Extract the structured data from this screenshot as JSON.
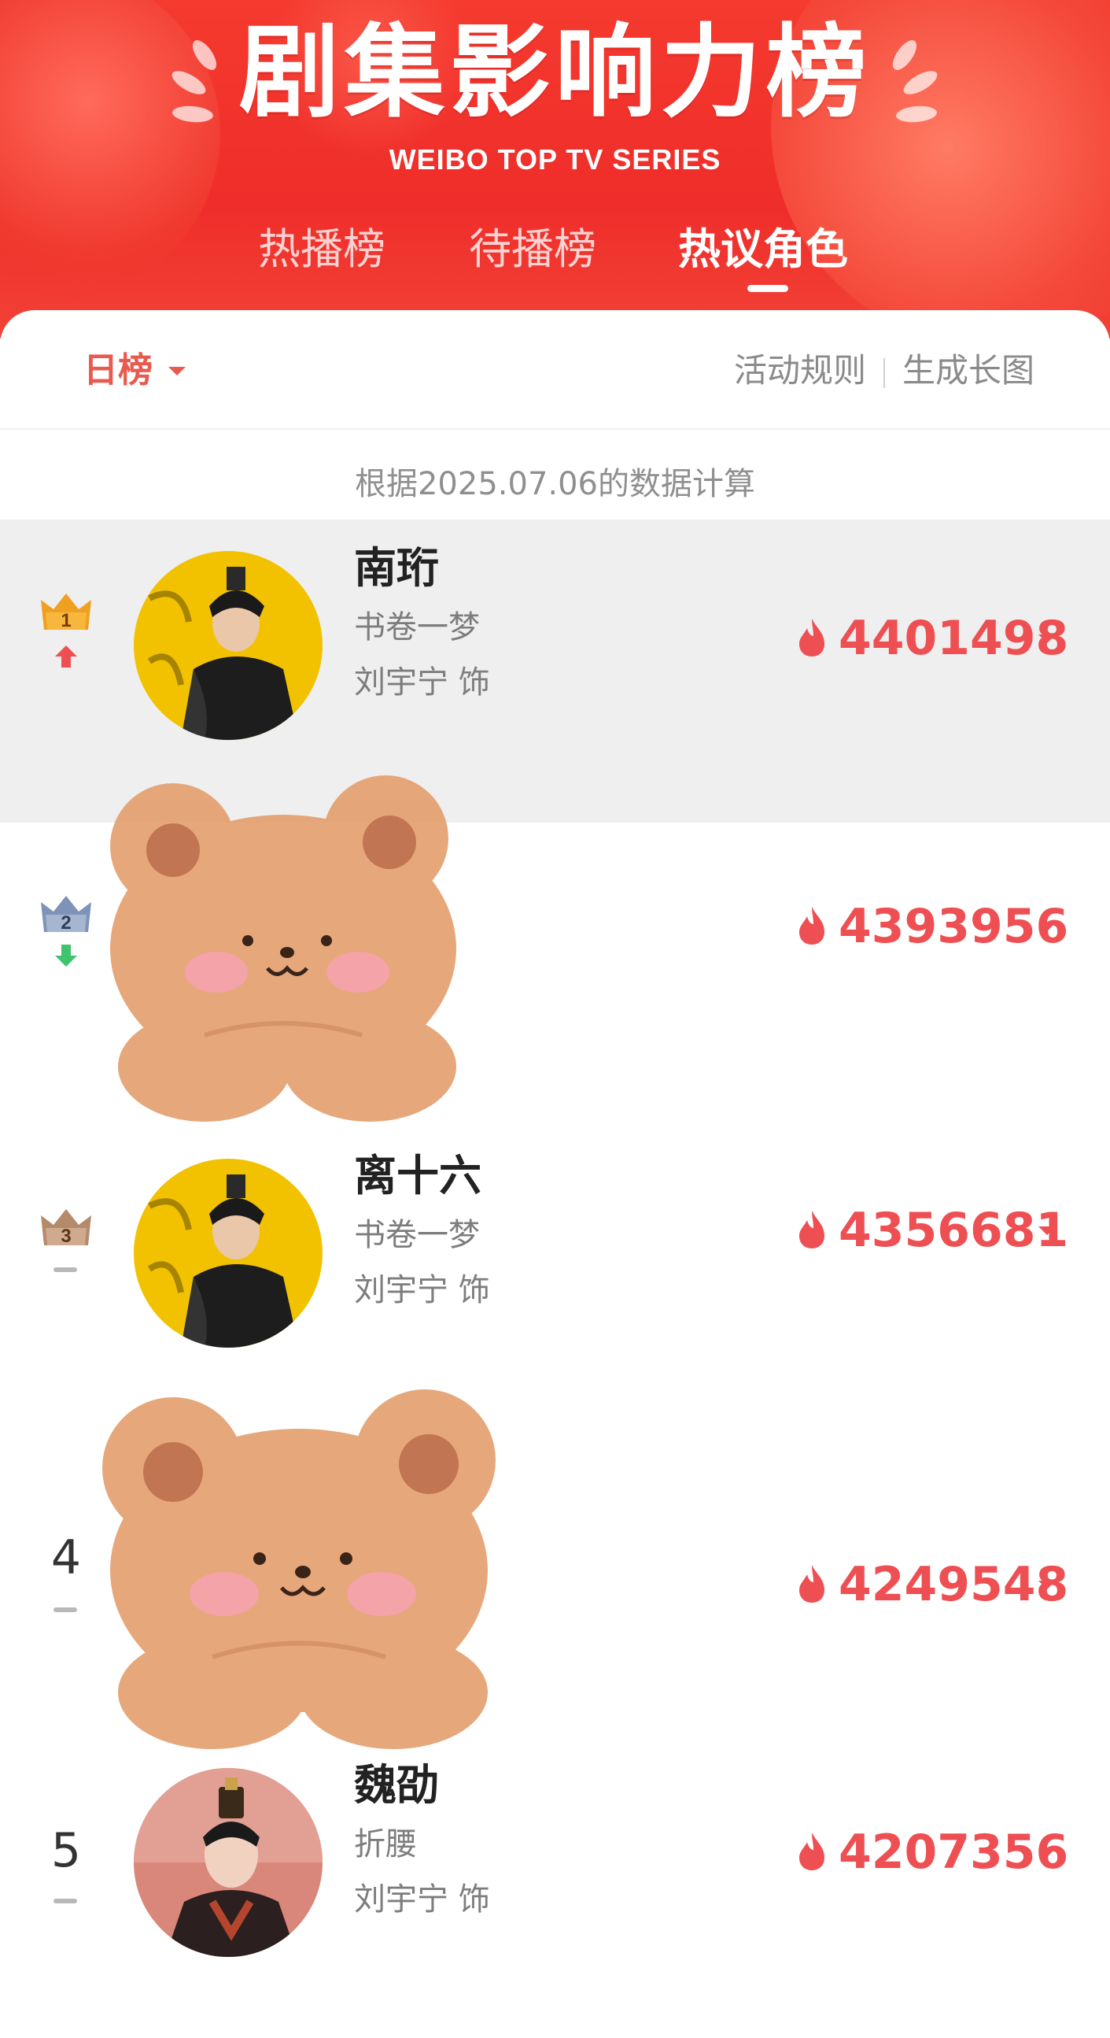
{
  "header": {
    "title": "剧集影响力榜",
    "subtitle": "WEIBO TOP TV SERIES",
    "tabs": [
      {
        "label": "热播榜",
        "active": false
      },
      {
        "label": "待播榜",
        "active": false
      },
      {
        "label": "热议角色",
        "active": true
      }
    ]
  },
  "filter": {
    "period": "日榜",
    "rules_link": "活动规则",
    "image_link": "生成长图"
  },
  "calc_note": "根据2025.07.06的数据计算",
  "colors": {
    "header_red": "#ef2d2a",
    "accent": "#e85a4f",
    "heat": "#ee4f53",
    "trend_up": "#ee4f53",
    "trend_down": "#3ec46d",
    "gold": "#f0a020",
    "silver": "#7d93b8",
    "bronze": "#b58a6b"
  },
  "rows": [
    {
      "rank": "1",
      "badge": "gold-crown-icon",
      "trend": "up",
      "name": "南珩",
      "drama": "书卷一梦",
      "actor": "刘宇宁 饰",
      "heat": "4401498",
      "avatar": "yellow-portrait"
    },
    {
      "rank": "2",
      "badge": "silver-crown-icon",
      "trend": "down",
      "name": "",
      "drama": "",
      "actor": "",
      "heat": "4393956",
      "avatar": "covered-by-bear-sticker"
    },
    {
      "rank": "3",
      "badge": "bronze-crown-icon",
      "trend": "same",
      "name": "离十六",
      "drama": "书卷一梦",
      "actor": "刘宇宁 饰",
      "heat": "4356681",
      "avatar": "yellow-portrait"
    },
    {
      "rank": "4",
      "badge": "",
      "trend": "same",
      "name": "",
      "drama": "",
      "actor": "",
      "heat": "4249548",
      "avatar": "covered-by-bear-sticker"
    },
    {
      "rank": "5",
      "badge": "",
      "trend": "same",
      "name": "魏劭",
      "drama": "折腰",
      "actor": "刘宇宁 饰",
      "heat": "4207356",
      "avatar": "red-portrait"
    }
  ]
}
